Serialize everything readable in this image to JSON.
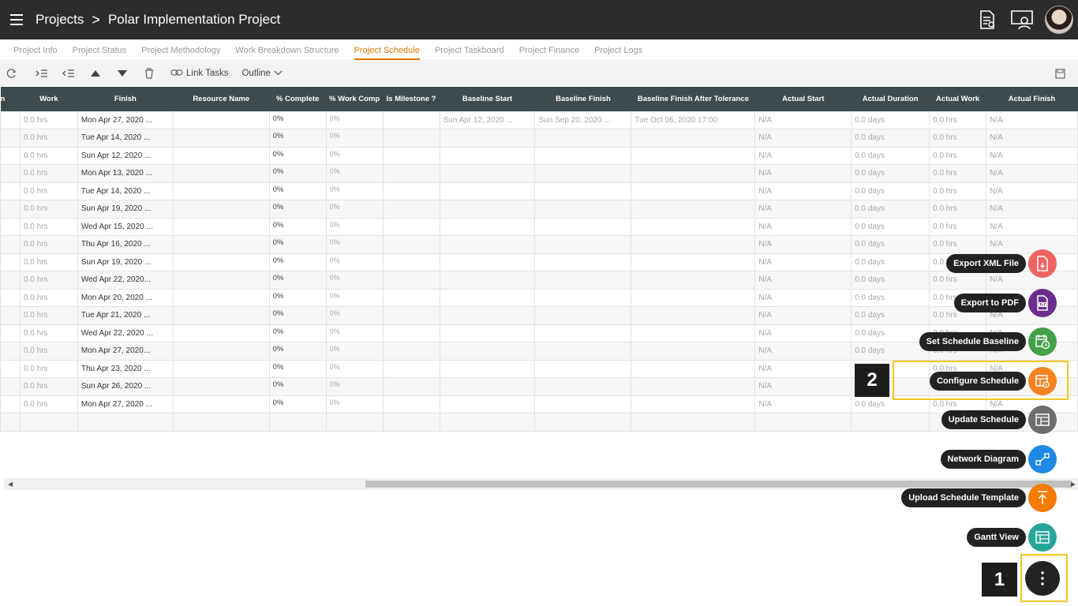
{
  "breadcrumb": {
    "root": "Projects",
    "separator": ">",
    "current": "Polar Implementation Project"
  },
  "tabs": [
    {
      "label": "Project Info"
    },
    {
      "label": "Project Status"
    },
    {
      "label": "Project Methodology"
    },
    {
      "label": "Work Breakdown Structure"
    },
    {
      "label": "Project Schedule",
      "active": true
    },
    {
      "label": "Project Taskboard"
    },
    {
      "label": "Project Finance"
    },
    {
      "label": "Project Logs"
    }
  ],
  "toolbar": {
    "link_tasks": "Link Tasks",
    "outline": "Outline"
  },
  "grid": {
    "columns": [
      "n",
      "Work",
      "Finish",
      "Resource Name",
      "% Complete",
      "% Work Comp",
      "Is Milestone ?",
      "Baseline Start",
      "Baseline Finish",
      "Baseline Finish After Tolerance",
      "Actual Start",
      "Actual Duration",
      "Actual Work",
      "Actual Finish"
    ],
    "rows": [
      {
        "work": "0.0 hrs",
        "finish": "Mon Apr 27, 2020 ...",
        "pct": "0%",
        "pctw": "0%",
        "bstart": "Sun Apr 12, 2020 ...",
        "bfinish": "Sun Sep 20, 2020 ...",
        "btol": "Tue Oct 06, 2020 17:00",
        "astart": "N/A",
        "adur": "0.0 days",
        "awork": "0.0 hrs",
        "afinish": "N/A"
      },
      {
        "work": "0.0 hrs",
        "finish": "Tue Apr 14, 2020 ...",
        "pct": "0%",
        "pctw": "0%",
        "bstart": "",
        "bfinish": "",
        "btol": "",
        "astart": "N/A",
        "adur": "0.0 days",
        "awork": "0.0 hrs",
        "afinish": "N/A"
      },
      {
        "work": "0.0 hrs",
        "finish": "Sun Apr 12, 2020 ...",
        "pct": "0%",
        "pctw": "0%",
        "bstart": "",
        "bfinish": "",
        "btol": "",
        "astart": "N/A",
        "adur": "0.0 days",
        "awork": "0.0 hrs",
        "afinish": "N/A"
      },
      {
        "work": "0.0 hrs",
        "finish": "Mon Apr 13, 2020 ...",
        "pct": "0%",
        "pctw": "0%",
        "bstart": "",
        "bfinish": "",
        "btol": "",
        "astart": "N/A",
        "adur": "0.0 days",
        "awork": "0.0 hrs",
        "afinish": "N/A"
      },
      {
        "work": "0.0 hrs",
        "finish": "Tue Apr 14, 2020 ...",
        "pct": "0%",
        "pctw": "0%",
        "bstart": "",
        "bfinish": "",
        "btol": "",
        "astart": "N/A",
        "adur": "0.0 days",
        "awork": "0.0 hrs",
        "afinish": "N/A"
      },
      {
        "work": "0.0 hrs",
        "finish": "Sun Apr 19, 2020 ...",
        "pct": "0%",
        "pctw": "0%",
        "bstart": "",
        "bfinish": "",
        "btol": "",
        "astart": "N/A",
        "adur": "0.0 days",
        "awork": "0.0 hrs",
        "afinish": "N/A"
      },
      {
        "work": "0.0 hrs",
        "finish": "Wed Apr 15, 2020 ...",
        "pct": "0%",
        "pctw": "0%",
        "bstart": "",
        "bfinish": "",
        "btol": "",
        "astart": "N/A",
        "adur": "0.0 days",
        "awork": "0.0 hrs",
        "afinish": "N/A"
      },
      {
        "work": "0.0 hrs",
        "finish": "Thu Apr 16, 2020 ...",
        "pct": "0%",
        "pctw": "0%",
        "bstart": "",
        "bfinish": "",
        "btol": "",
        "astart": "N/A",
        "adur": "0.0 days",
        "awork": "0.0 hrs",
        "afinish": "N/A"
      },
      {
        "work": "0.0 hrs",
        "finish": "Sun Apr 19, 2020 ...",
        "pct": "0%",
        "pctw": "0%",
        "bstart": "",
        "bfinish": "",
        "btol": "",
        "astart": "N/A",
        "adur": "0.0 days",
        "awork": "0.0 hrs",
        "afinish": "N/A"
      },
      {
        "work": "0.0 hrs",
        "finish": "Wed Apr 22, 2020...",
        "pct": "0%",
        "pctw": "0%",
        "bstart": "",
        "bfinish": "",
        "btol": "",
        "astart": "N/A",
        "adur": "0.0 days",
        "awork": "0.0 hrs",
        "afinish": "N/A"
      },
      {
        "work": "0.0 hrs",
        "finish": "Mon Apr 20, 2020 ...",
        "pct": "0%",
        "pctw": "0%",
        "bstart": "",
        "bfinish": "",
        "btol": "",
        "astart": "N/A",
        "adur": "0.0 days",
        "awork": "0.0 hrs",
        "afinish": "N/A"
      },
      {
        "work": "0.0 hrs",
        "finish": "Tue Apr 21, 2020 ...",
        "pct": "0%",
        "pctw": "0%",
        "bstart": "",
        "bfinish": "",
        "btol": "",
        "astart": "N/A",
        "adur": "0.0 days",
        "awork": "0.0 hrs",
        "afinish": "N/A"
      },
      {
        "work": "0.0 hrs",
        "finish": "Wed Apr 22, 2020 ...",
        "pct": "0%",
        "pctw": "0%",
        "bstart": "",
        "bfinish": "",
        "btol": "",
        "astart": "N/A",
        "adur": "0.0 days",
        "awork": "0.0 hrs",
        "afinish": "N/A"
      },
      {
        "work": "0.0 hrs",
        "finish": "Mon Apr 27, 2020...",
        "pct": "0%",
        "pctw": "0%",
        "bstart": "",
        "bfinish": "",
        "btol": "",
        "astart": "N/A",
        "adur": "0.0 days",
        "awork": "0.0 hrs",
        "afinish": "N/A"
      },
      {
        "work": "0.0 hrs",
        "finish": "Thu Apr 23, 2020 ...",
        "pct": "0%",
        "pctw": "0%",
        "bstart": "",
        "bfinish": "",
        "btol": "",
        "astart": "N/A",
        "adur": "0.0 days",
        "awork": "0.0 hrs",
        "afinish": "N/A"
      },
      {
        "work": "0.0 hrs",
        "finish": "Sun Apr 26, 2020 ...",
        "pct": "0%",
        "pctw": "0%",
        "bstart": "",
        "bfinish": "",
        "btol": "",
        "astart": "N/A",
        "adur": "0.0 days",
        "awork": "0.0 hrs",
        "afinish": "N/A"
      },
      {
        "work": "0.0 hrs",
        "finish": "Mon Apr 27, 2020 ...",
        "pct": "0%",
        "pctw": "0%",
        "bstart": "",
        "bfinish": "",
        "btol": "",
        "astart": "N/A",
        "adur": "0.0 days",
        "awork": "0.0 hrs",
        "afinish": "N/A"
      },
      {
        "work": "",
        "finish": "",
        "pct": "",
        "pctw": "",
        "bstart": "",
        "bfinish": "",
        "btol": "",
        "astart": "",
        "adur": "",
        "awork": "",
        "afinish": ""
      }
    ]
  },
  "fab_menu": {
    "items": [
      {
        "label": "Export XML File",
        "icon": "xml-file-icon",
        "color": "#f06363"
      },
      {
        "label": "Export to PDF",
        "icon": "pdf-file-icon",
        "color": "#6a2f8c"
      },
      {
        "label": "Set Schedule Baseline",
        "icon": "calendar-clock-icon",
        "color": "#43a047"
      },
      {
        "label": "Configure Schedule",
        "icon": "configure-table-icon",
        "color": "#f58220"
      },
      {
        "label": "Update Schedule",
        "icon": "update-table-icon",
        "color": "#6d6d6d"
      },
      {
        "label": "Network Diagram",
        "icon": "network-diagram-icon",
        "color": "#1e88e5"
      },
      {
        "label": "Upload Schedule Template",
        "icon": "upload-icon",
        "color": "#f57c00"
      },
      {
        "label": "Gantt View",
        "icon": "gantt-icon",
        "color": "#26a69a"
      }
    ]
  },
  "callouts": [
    {
      "label": "1"
    },
    {
      "label": "2"
    }
  ],
  "colors": {
    "accent": "#e07b00",
    "header_bg": "#3e4b4e",
    "topbar_bg": "#2c2c2c",
    "highlight": "#f3c623"
  }
}
